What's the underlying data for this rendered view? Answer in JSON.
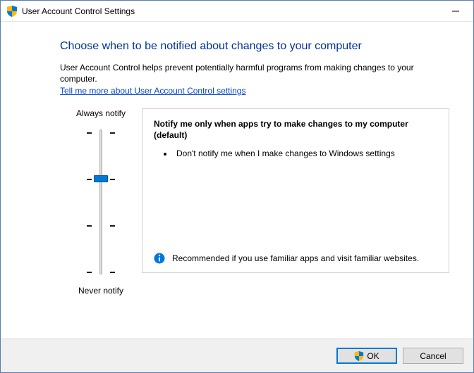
{
  "window": {
    "title": "User Account Control Settings"
  },
  "heading": "Choose when to be notified about changes to your computer",
  "description": "User Account Control helps prevent potentially harmful programs from making changes to your computer.",
  "help_link": "Tell me more about User Account Control settings",
  "slider": {
    "top_label": "Always notify",
    "bottom_label": "Never notify",
    "levels": 4,
    "current_level_index": 1
  },
  "detail": {
    "title": "Notify me only when apps try to make changes to my computer (default)",
    "bullets": [
      "Don't notify me when I make changes to Windows settings"
    ],
    "recommendation": "Recommended if you use familiar apps and visit familiar websites."
  },
  "buttons": {
    "ok": "OK",
    "cancel": "Cancel"
  },
  "icons": {
    "shield": "uac-shield",
    "info": "info",
    "minimize": "minimize"
  }
}
